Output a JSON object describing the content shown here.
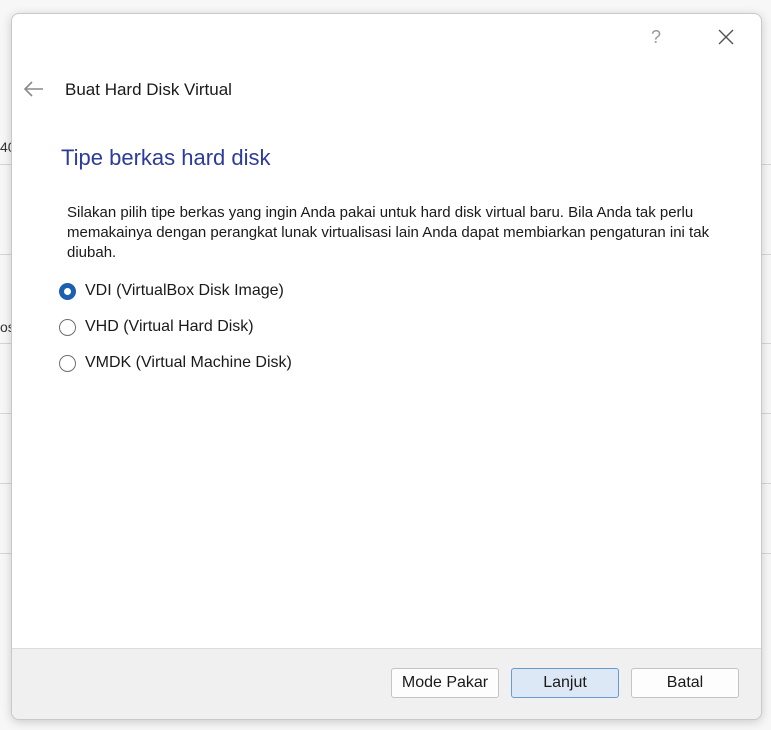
{
  "background": {
    "fragment_1": "40",
    "fragment_2": "os"
  },
  "window": {
    "help_label": "?",
    "close_icon": "close-icon"
  },
  "wizard": {
    "back_icon": "arrow-left-icon",
    "title": "Buat Hard Disk Virtual",
    "heading": "Tipe berkas hard disk",
    "description": "Silakan pilih tipe berkas yang ingin Anda pakai untuk hard disk virtual baru. Bila Anda tak perlu memakainya dengan perangkat lunak virtualisasi lain Anda dapat membiarkan pengaturan ini tak diubah."
  },
  "options": [
    {
      "label": "VDI (VirtualBox Disk Image)",
      "selected": true
    },
    {
      "label": "VHD (Virtual Hard Disk)",
      "selected": false
    },
    {
      "label": "VMDK (Virtual Machine Disk)",
      "selected": false
    }
  ],
  "footer": {
    "expert_label": "Mode Pakar",
    "next_label": "Lanjut",
    "cancel_label": "Batal"
  },
  "colors": {
    "heading": "#2d3b9a",
    "radio_selected": "#1c5fae",
    "primary_button_bg": "#dce8f5"
  }
}
